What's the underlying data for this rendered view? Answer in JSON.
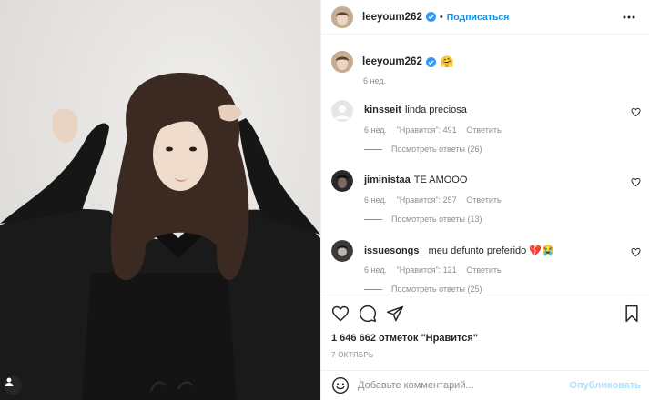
{
  "post": {
    "username": "leeyoum262",
    "follow_label": "Подписаться",
    "caption_emoji": "🤗",
    "caption_time": "6 нед.",
    "likes_text": "1 646 662 отметок \"Нравится\"",
    "date_text": "7 ОКТЯБРЬ"
  },
  "comments": [
    {
      "username": "kinsseit",
      "text": "linda preciosa",
      "time": "6 нед.",
      "likes": "\"Нравится\": 491",
      "reply_label": "Ответить",
      "replies_label": "Посмотреть ответы (26)"
    },
    {
      "username": "jiministaa",
      "text": "TE AMOOO",
      "time": "6 нед.",
      "likes": "\"Нравится\": 257",
      "reply_label": "Ответить",
      "replies_label": "Посмотреть ответы (13)"
    },
    {
      "username": "issuesongs_",
      "text": "meu defunto preferido 💔😭",
      "time": "6 нед.",
      "likes": "\"Нравится\": 121",
      "reply_label": "Ответить",
      "replies_label": "Посмотреть ответы (25)"
    }
  ],
  "add_comment": {
    "placeholder": "Добавьте комментарий...",
    "publish_label": "Опубликовать"
  },
  "colors": {
    "accent": "#0095f6",
    "publish_disabled": "#b2dffc",
    "secondary_text": "#8e8e8e",
    "verified": "#3897f0"
  },
  "icons": {
    "more": "more-horizontal-icon",
    "heart": "heart-icon",
    "comment": "comment-icon",
    "share": "share-icon",
    "bookmark": "bookmark-icon",
    "smile": "smile-icon",
    "verified": "verified-badge-icon",
    "user_tag": "user-tag-icon"
  }
}
